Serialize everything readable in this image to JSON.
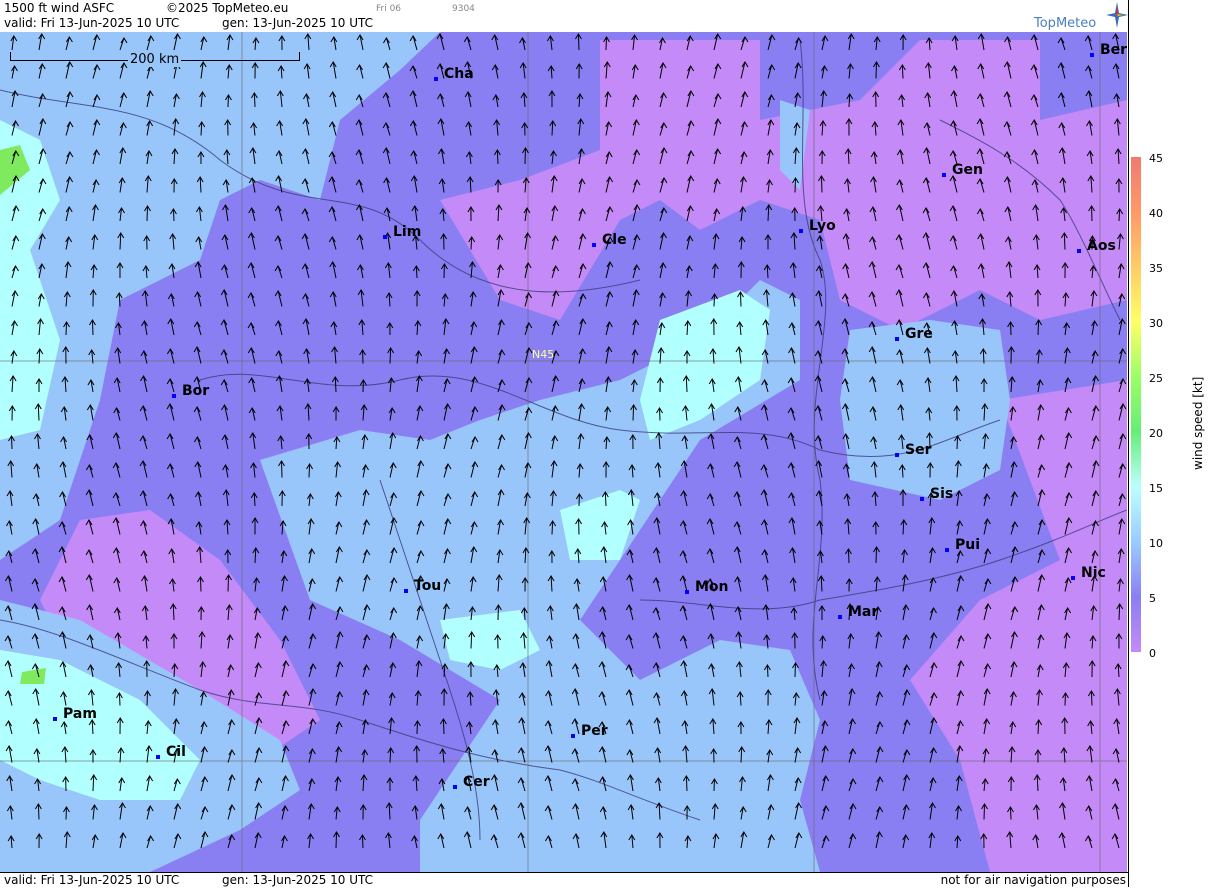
{
  "header": {
    "title": "1500 ft wind ASFC",
    "copyright": "©2025 TopMeteo.eu",
    "day": "Fri 06",
    "code": "9304",
    "valid": "valid:  Fri  13-Jun-2025  10 UTC",
    "gen": "gen: 13-Jun-2025 10 UTC",
    "brand": "TopMeteo"
  },
  "map": {
    "scale_label": "200 km",
    "lat_label": "N45",
    "cities": [
      "Cha",
      "Ber",
      "Gen",
      "Lim",
      "Cle",
      "Lyo",
      "Aos",
      "Gre",
      "Bor",
      "Ser",
      "Sis",
      "Pui",
      "Tou",
      "Mon",
      "Mar",
      "Nic",
      "Pam",
      "Cil",
      "Per",
      "Cer"
    ]
  },
  "legend": {
    "title": "wind  speed  [kt]",
    "ticks": [
      "45",
      "40",
      "35",
      "30",
      "25",
      "20",
      "15",
      "10",
      "5",
      "0"
    ],
    "colors": [
      "#f07a70",
      "#ff9966",
      "#ffcc66",
      "#ffff66",
      "#99ff66",
      "#66ee77",
      "#bbffff",
      "#99ccff",
      "#8a7ff2",
      "#c48af7"
    ]
  },
  "footer": {
    "valid": "valid:  Fri  13-Jun-2025  10 UTC",
    "gen": "gen: 13-Jun-2025 10 UTC",
    "note": "not for air navigation purposes"
  },
  "colors": {
    "purple": "#8a7ff2",
    "violet": "#c48af7",
    "lightblue": "#99c6fa",
    "cyan": "#b2ffff",
    "green": "#80ea5e"
  }
}
